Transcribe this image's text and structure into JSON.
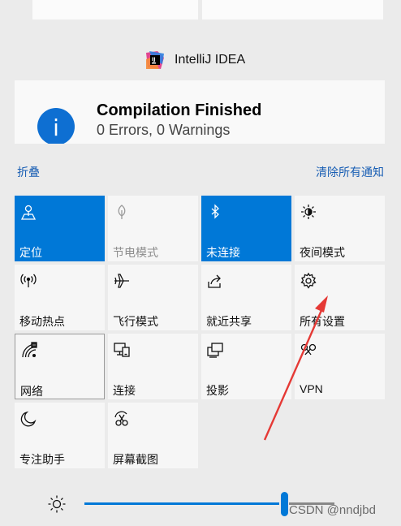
{
  "notification": {
    "app_name": "IntelliJ IDEA",
    "title": "Compilation Finished",
    "body": "0 Errors, 0 Warnings",
    "badge_letter": "i"
  },
  "actions": {
    "collapse_label": "折叠",
    "clear_all_label": "清除所有通知"
  },
  "quick_actions": [
    {
      "label": "定位",
      "icon": "location-icon",
      "state": "active"
    },
    {
      "label": "节电模式",
      "icon": "battery-saver-icon",
      "state": "disabled"
    },
    {
      "label": "未连接",
      "icon": "bluetooth-icon",
      "state": "active"
    },
    {
      "label": "夜间模式",
      "icon": "night-light-icon",
      "state": "normal"
    },
    {
      "label": "移动热点",
      "icon": "mobile-hotspot-icon",
      "state": "normal"
    },
    {
      "label": "飞行模式",
      "icon": "airplane-icon",
      "state": "normal"
    },
    {
      "label": "就近共享",
      "icon": "nearby-share-icon",
      "state": "normal"
    },
    {
      "label": "所有设置",
      "icon": "gear-icon",
      "state": "normal"
    },
    {
      "label": "网络",
      "icon": "network-icon",
      "state": "selected"
    },
    {
      "label": "连接",
      "icon": "connect-icon",
      "state": "normal"
    },
    {
      "label": "投影",
      "icon": "project-icon",
      "state": "normal"
    },
    {
      "label": "VPN",
      "icon": "vpn-icon",
      "state": "normal"
    },
    {
      "label": "专注助手",
      "icon": "focus-assist-icon",
      "state": "normal"
    },
    {
      "label": "屏幕截图",
      "icon": "screen-snip-icon",
      "state": "normal"
    }
  ],
  "brightness": {
    "icon": "brightness-icon",
    "level": 0.8
  },
  "watermark": "CSDN @nndjbd",
  "colors": {
    "accent": "#0078d7",
    "link": "#1a5fb4",
    "annotation_arrow": "#e53935"
  }
}
